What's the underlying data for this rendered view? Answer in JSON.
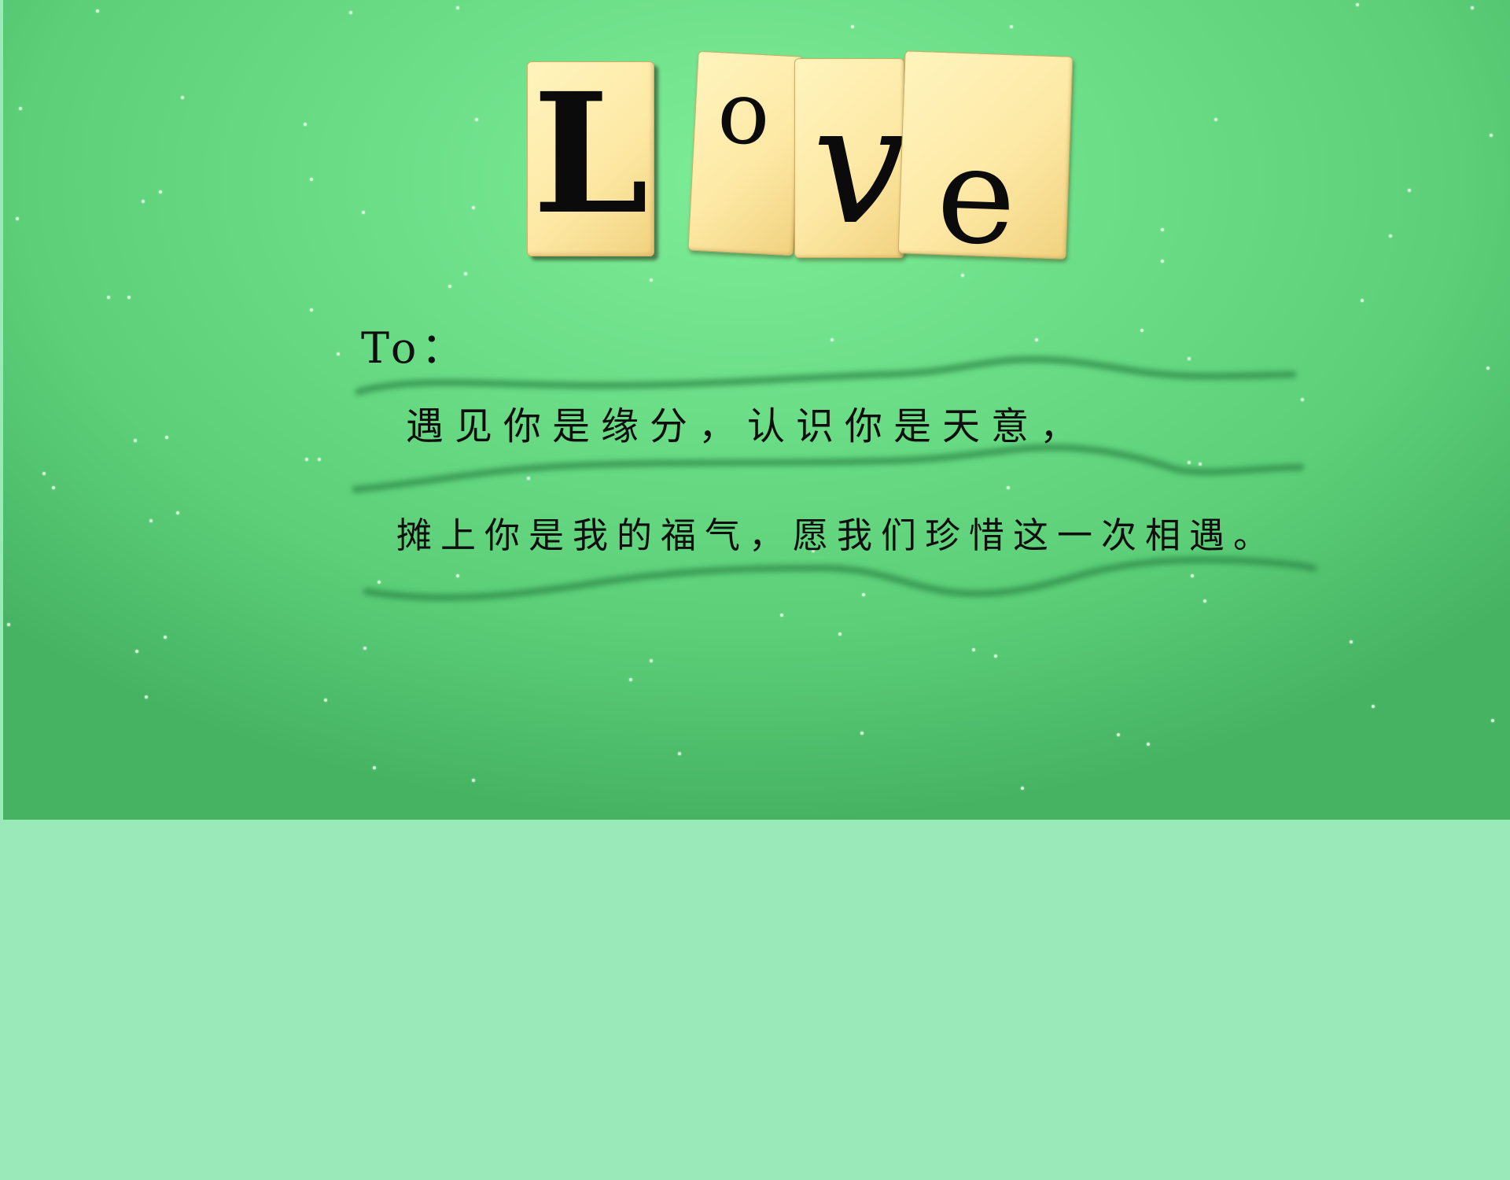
{
  "title": {
    "tiles": [
      {
        "letter": "L"
      },
      {
        "letter": "o"
      },
      {
        "letter": "v"
      },
      {
        "letter": "e"
      }
    ]
  },
  "letter": {
    "to_label": "To：",
    "line1": "遇见你是缘分，认识你是天意，",
    "line2": "摊上你是我的福气，愿我们珍惜这一次相遇。"
  },
  "colors": {
    "card_green": "#6adc86",
    "page_mint": "#9ae9b8",
    "tile_cream": "#fde9a6",
    "ink": "#0e0e0e",
    "wave_shadow": "#2f8a4a"
  }
}
